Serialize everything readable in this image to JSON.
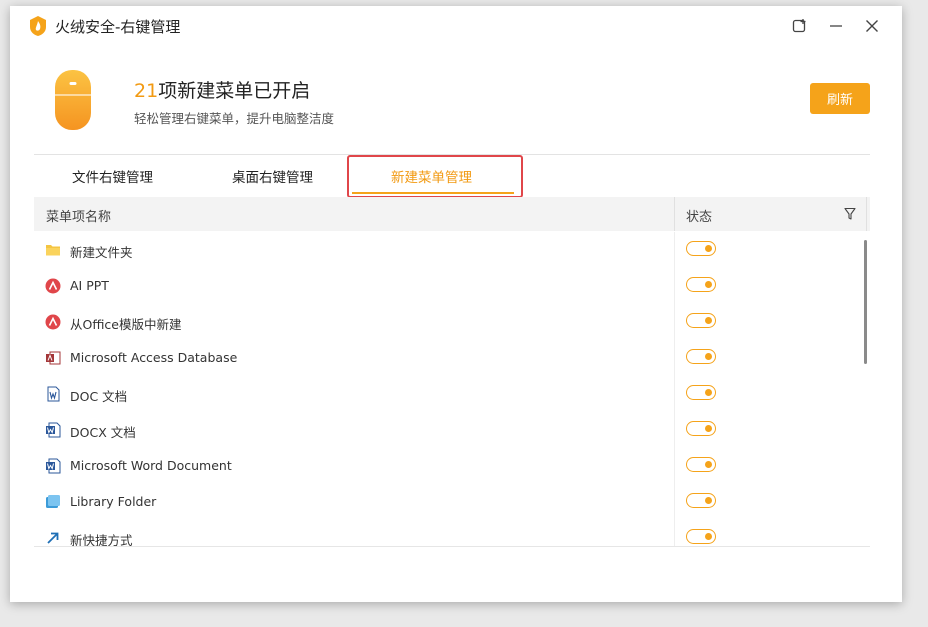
{
  "window": {
    "title": "火绒安全-右键管理",
    "controls": [
      "pin-icon",
      "minimize-icon",
      "close-icon"
    ]
  },
  "header": {
    "count": "21",
    "title_suffix": "项新建菜单已开启",
    "subtitle": "轻松管理右键菜单，提升电脑整洁度",
    "refresh_label": "刷新",
    "icon": "mouse-icon"
  },
  "tabs": [
    {
      "label": "文件右键管理",
      "active": false
    },
    {
      "label": "桌面右键管理",
      "active": false
    },
    {
      "label": "新建菜单管理",
      "active": true
    }
  ],
  "table": {
    "col_name": "菜单项名称",
    "col_status": "状态",
    "filter_icon": "filter-icon",
    "rows": [
      {
        "label": "新建文件夹",
        "icon": "folder-icon",
        "enabled": true
      },
      {
        "label": "AI PPT",
        "icon": "ai-ppt-icon",
        "enabled": true
      },
      {
        "label": "从Office模版中新建",
        "icon": "office-template-icon",
        "enabled": true
      },
      {
        "label": "Microsoft Access Database",
        "icon": "access-icon",
        "enabled": true
      },
      {
        "label": "DOC 文档",
        "icon": "doc-icon",
        "enabled": true
      },
      {
        "label": "DOCX 文档",
        "icon": "docx-icon",
        "enabled": true
      },
      {
        "label": "Microsoft Word Document",
        "icon": "word-icon",
        "enabled": true
      },
      {
        "label": "Library Folder",
        "icon": "library-icon",
        "enabled": true
      },
      {
        "label": "新快捷方式",
        "icon": "shortcut-icon",
        "enabled": true
      }
    ]
  },
  "colors": {
    "accent": "#f5a31a",
    "highlight_border": "#e0464a"
  }
}
